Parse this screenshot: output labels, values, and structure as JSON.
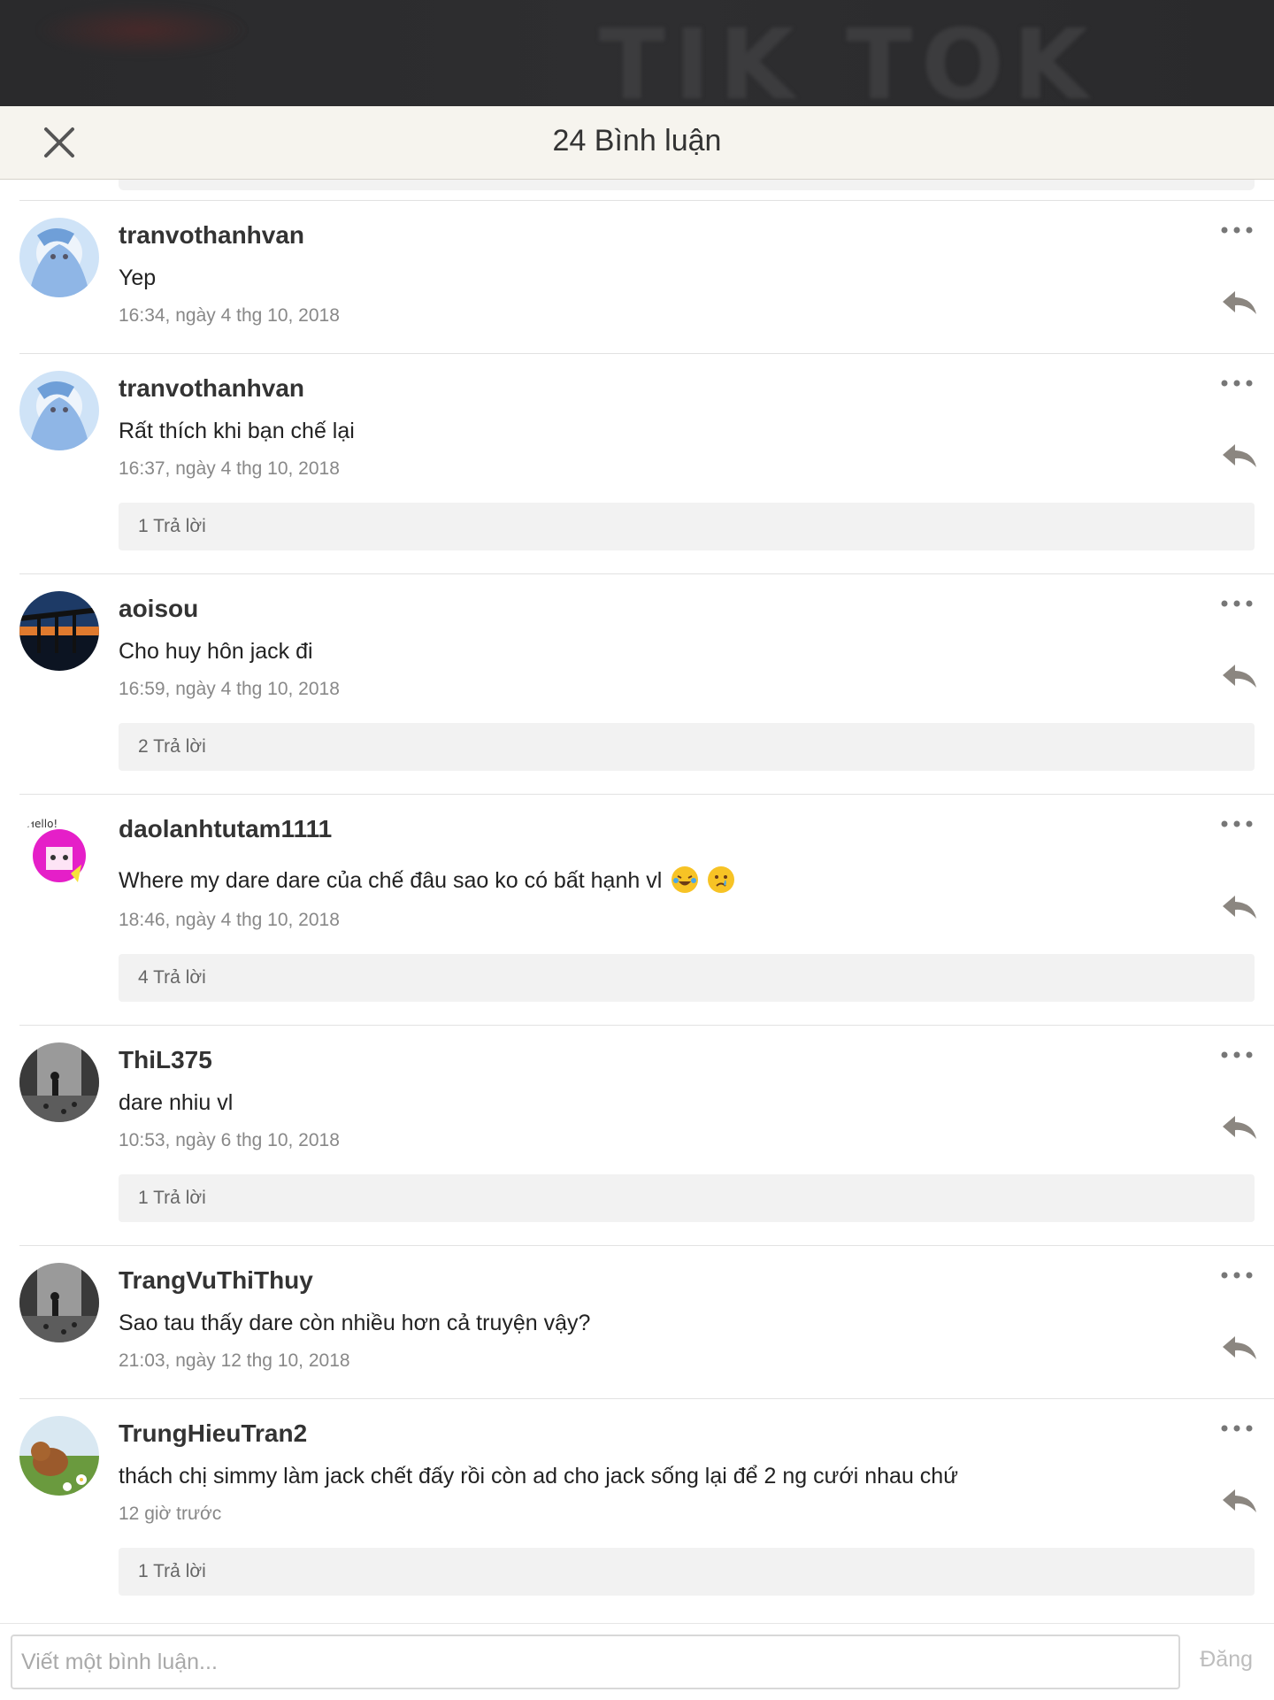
{
  "header": {
    "title": "24 Bình luận",
    "close_icon": "close-icon"
  },
  "background": {
    "watermark": "TIK TOK"
  },
  "colors": {
    "header_bg": "#f6f4ee",
    "accent_text": "#333333",
    "reply_bar": "#f2f2f2"
  },
  "comments": [
    {
      "username": "tranvothanhvan",
      "text": "Yep",
      "time": "16:34, ngày 4 thg 10, 2018",
      "replies": ""
    },
    {
      "username": "tranvothanhvan",
      "text": "Rất thích khi bạn chế lại",
      "time": "16:37, ngày 4 thg 10, 2018",
      "replies": "1 Trả lời"
    },
    {
      "username": "aoisou",
      "text": "Cho huy hôn jack đi",
      "time": "16:59, ngày 4 thg 10, 2018",
      "replies": "2 Trả lời"
    },
    {
      "username": "daolanhtutam1111",
      "text": "Where my dare dare của chế đâu sao ko có bất hạnh vl",
      "time": "18:46, ngày 4 thg 10, 2018",
      "replies": "4 Trả lời",
      "emojis": [
        "laughing-crying-emoji",
        "crying-emoji"
      ]
    },
    {
      "username": "ThiL375",
      "text": "dare nhiu vl",
      "time": "10:53, ngày 6 thg 10, 2018",
      "replies": "1 Trả lời"
    },
    {
      "username": "TrangVuThiThuy",
      "text": "Sao tau thấy dare còn nhiều hơn cả truyện vậy?",
      "time": "21:03, ngày 12 thg 10, 2018",
      "replies": ""
    },
    {
      "username": "TrungHieuTran2",
      "text": "thách chị simmy làm jack chết đấy rồi còn ad cho jack sống lại để 2 ng cưới nhau chứ",
      "time": "12 giờ trước",
      "replies": "1 Trả lời"
    }
  ],
  "footer": {
    "placeholder": "Viết một bình luận...",
    "post_label": "Đăng"
  }
}
